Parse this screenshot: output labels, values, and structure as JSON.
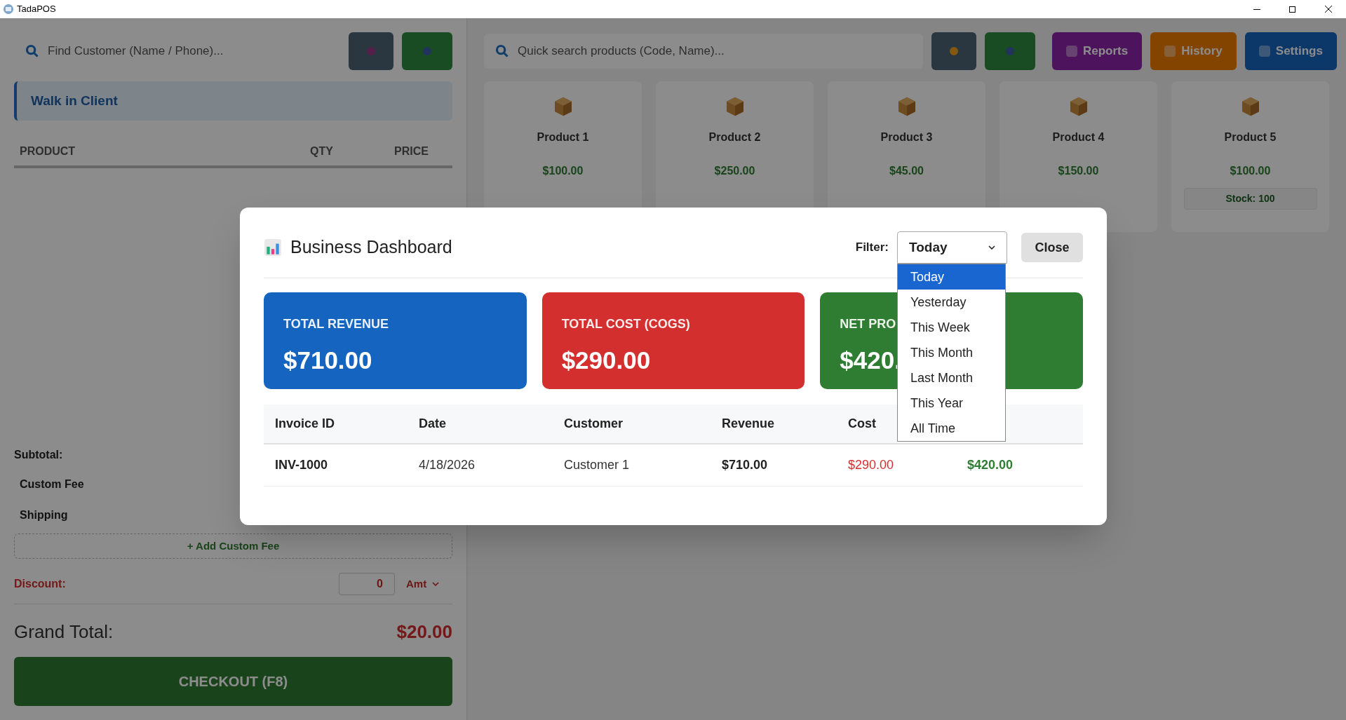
{
  "window": {
    "title": "TadaPOS"
  },
  "cart_panel": {
    "customer_search": {
      "placeholder": "Find Customer (Name / Phone)..."
    },
    "client": "Walk in Client",
    "columns": [
      "PRODUCT",
      "QTY",
      "PRICE"
    ],
    "summary": [
      "Subtotal:",
      "Custom Fee",
      "Shipping"
    ],
    "add_fee": "+ Add Custom Fee",
    "discount": {
      "label": "Discount:",
      "value": "0",
      "unit": "Amt"
    },
    "grand_total_label": "Grand Total:",
    "grand_total": "$20.00",
    "checkout": "CHECKOUT (F8)"
  },
  "product_panel": {
    "search": {
      "placeholder": "Quick search products (Code, Name)..."
    },
    "toolbar": [
      {
        "label": "Reports"
      },
      {
        "label": "History"
      },
      {
        "label": "Settings"
      }
    ],
    "products": [
      {
        "name": "Product 1",
        "price": "$100.00"
      },
      {
        "name": "Product 2",
        "price": "$250.00"
      },
      {
        "name": "Product 3",
        "price": "$45.00"
      },
      {
        "name": "Product 4",
        "price": "$150.00"
      },
      {
        "name": "Product 5",
        "price": "$100.00",
        "stock": "Stock: 100"
      }
    ]
  },
  "dashboard": {
    "title": "Business Dashboard",
    "filter_label": "Filter:",
    "filter_value": "Today",
    "close": "Close",
    "filter_options": [
      {
        "label": "Today",
        "selected": true
      },
      {
        "label": "Yesterday",
        "selected": false
      },
      {
        "label": "This Week",
        "selected": false
      },
      {
        "label": "This Month",
        "selected": false
      },
      {
        "label": "Last Month",
        "selected": false
      },
      {
        "label": "This Year",
        "selected": false
      },
      {
        "label": "All Time",
        "selected": false
      }
    ],
    "cards": [
      {
        "label": "TOTAL REVENUE",
        "value": "$710.00",
        "color": "#1565c0"
      },
      {
        "label": "TOTAL COST (COGS)",
        "value": "$290.00",
        "color": "#d32f2f"
      },
      {
        "label": "NET PRO",
        "value": "$420.",
        "color": "#2e7d32"
      }
    ],
    "table": {
      "columns": [
        "Invoice ID",
        "Date",
        "Customer",
        "Revenue",
        "Cost"
      ],
      "rows": [
        [
          "INV-1000",
          "4/18/2026",
          "Customer 1",
          "$710.00",
          "$290.00",
          "$420.00"
        ]
      ]
    }
  }
}
